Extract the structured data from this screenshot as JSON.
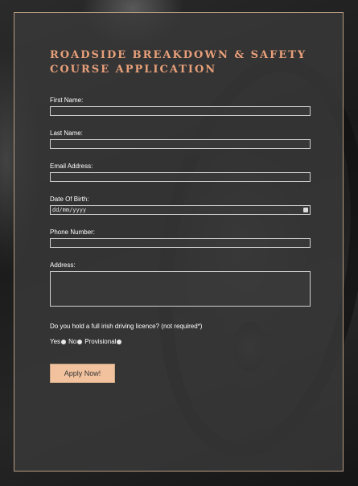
{
  "form": {
    "title": "ROADSIDE BREAKDOWN & SAFETY COURSE APPLICATION",
    "first_name_label": "First Name:",
    "last_name_label": "Last Name:",
    "email_label": "Email Address:",
    "dob_label": "Date Of Birth:",
    "dob_placeholder": "dd/mm/yyyy",
    "phone_label": "Phone Number:",
    "address_label": "Address:",
    "licence_question": "Do you hold a full irish driving licence? (not required*)",
    "radio_options": [
      "Yes",
      "No",
      "Provisional"
    ],
    "submit_label": "Apply Now!"
  },
  "colors": {
    "accent": "#e8a07a",
    "button_bg": "#f2c29e",
    "panel_border": "#b59a82"
  },
  "icons": {
    "date_picker": "calendar-icon"
  }
}
